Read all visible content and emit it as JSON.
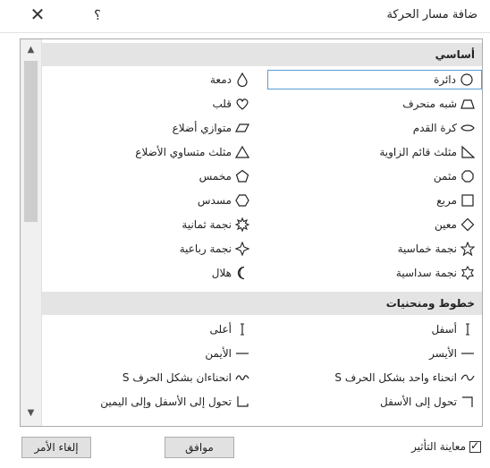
{
  "dialog": {
    "title": "ضافة مسار الحركة",
    "close_glyph": "✕",
    "help_glyph": "؟"
  },
  "groups": {
    "basic": "أساسي",
    "lines": "خطوط ومنحنيات"
  },
  "basic_items": {
    "circle": "دائرة",
    "teardrop": "دمعة",
    "trapezoid": "شبه منحرف",
    "heart": "قلب",
    "football": "كرة القدم",
    "parallelogram": "متوازي أضلاع",
    "right_triangle": "مثلث قائم الزاوية",
    "isosceles_triangle": "مثلث متساوي الأضلاع",
    "octagon": "مثمن",
    "pentagon": "مخمس",
    "square": "مربع",
    "hexagon": "مسدس",
    "diamond": "معين",
    "eight_point_star": "نجمة ثمانية",
    "five_point_star": "نجمة خماسية",
    "four_point_star": "نجمة رباعية",
    "six_point_star": "نجمة سداسية",
    "crescent": "هلال"
  },
  "line_items": {
    "down": "أسفل",
    "up": "أعلى",
    "left": "الأيسر",
    "right": "الأيمن",
    "s_curve_1": "انحناء واحد بشكل الحرف S",
    "s_curve_2": "انحناءان بشكل الحرف S",
    "turn_down": "تحول إلى الأسفل",
    "turn_down_right": "تحول إلى الأسفل وإلى اليمين"
  },
  "footer": {
    "preview_label": "معاينة التأثير",
    "preview_checked": true,
    "ok_label": "موافق",
    "cancel_label": "إلغاء الأمر"
  },
  "colors": {
    "selection_border": "#5b9bd5",
    "group_header_bg": "#e4e4e4",
    "button_bg": "#e1e1e1"
  }
}
